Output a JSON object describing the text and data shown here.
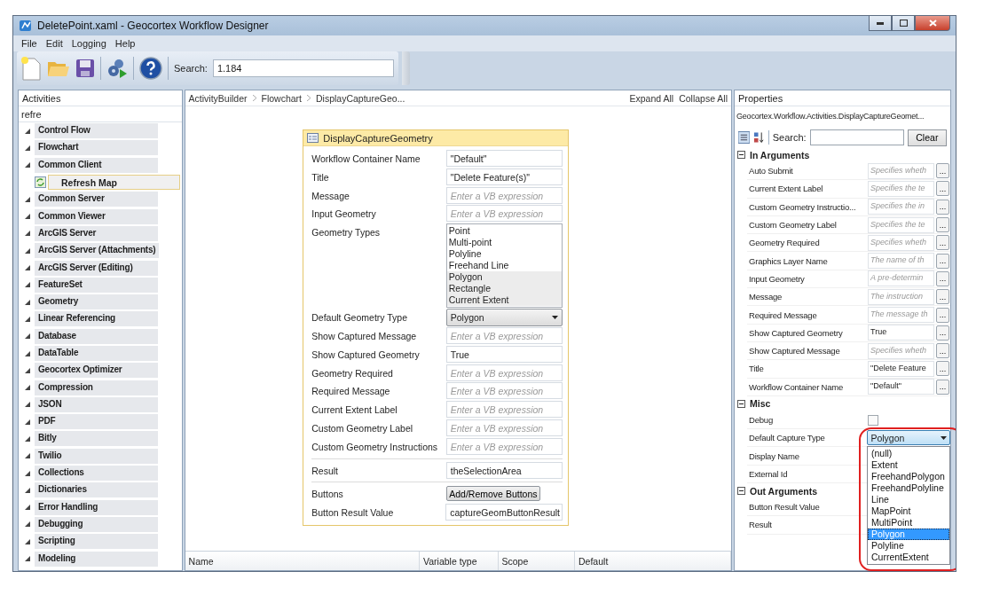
{
  "window": {
    "title": "DeletePoint.xaml - Geocortex Workflow Designer"
  },
  "menu": [
    "File",
    "Edit",
    "Logging",
    "Help"
  ],
  "toolbar": {
    "search_label": "Search:",
    "search_value": "1.184"
  },
  "activities": {
    "title": "Activities",
    "filter": "refre",
    "groups": [
      {
        "label": "Control Flow",
        "expanded": true
      },
      {
        "label": "Flowchart",
        "expanded": true
      },
      {
        "label": "Common Client",
        "expanded": true,
        "children": [
          {
            "label": "Refresh Map",
            "selected": true
          }
        ]
      },
      {
        "label": "Common Server",
        "expanded": true
      },
      {
        "label": "Common Viewer",
        "expanded": true
      },
      {
        "label": "ArcGIS Server",
        "expanded": true
      },
      {
        "label": "ArcGIS Server (Attachments)",
        "expanded": true
      },
      {
        "label": "ArcGIS Server (Editing)",
        "expanded": true
      },
      {
        "label": "FeatureSet",
        "expanded": true
      },
      {
        "label": "Geometry",
        "expanded": true
      },
      {
        "label": "Linear Referencing",
        "expanded": true
      },
      {
        "label": "Database",
        "expanded": true
      },
      {
        "label": "DataTable",
        "expanded": true
      },
      {
        "label": "Geocortex Optimizer",
        "expanded": true
      },
      {
        "label": "Compression",
        "expanded": true
      },
      {
        "label": "JSON",
        "expanded": true
      },
      {
        "label": "PDF",
        "expanded": true
      },
      {
        "label": "Bitly",
        "expanded": true
      },
      {
        "label": "Twilio",
        "expanded": true
      },
      {
        "label": "Collections",
        "expanded": true
      },
      {
        "label": "Dictionaries",
        "expanded": true
      },
      {
        "label": "Error Handling",
        "expanded": true
      },
      {
        "label": "Debugging",
        "expanded": true
      },
      {
        "label": "Scripting",
        "expanded": true
      },
      {
        "label": "Modeling",
        "expanded": true
      }
    ]
  },
  "designer": {
    "breadcrumb": [
      "ActivityBuilder",
      "Flowchart",
      "DisplayCaptureGeo..."
    ],
    "expand_all": "Expand All",
    "collapse_all": "Collapse All",
    "activity": {
      "title": "DisplayCaptureGeometry",
      "sections": [
        [
          {
            "label": "Workflow Container Name",
            "kind": "text",
            "value": "\"Default\""
          },
          {
            "label": "Title",
            "kind": "text",
            "value": "\"Delete Feature(s)\""
          },
          {
            "label": "Message",
            "kind": "text",
            "placeholder": "Enter a VB expression"
          },
          {
            "label": "Input Geometry",
            "kind": "text",
            "placeholder": "Enter a VB expression"
          },
          {
            "label": "Geometry Types",
            "kind": "list",
            "options": [
              {
                "label": "Point",
                "selected": false
              },
              {
                "label": "Multi-point",
                "selected": false
              },
              {
                "label": "Polyline",
                "selected": false
              },
              {
                "label": "Freehand Line",
                "selected": false
              },
              {
                "label": "Polygon",
                "selected": true
              },
              {
                "label": "Rectangle",
                "selected": true
              },
              {
                "label": "Current Extent",
                "selected": true
              }
            ]
          },
          {
            "label": "Default Geometry Type",
            "kind": "dropdown",
            "value": "Polygon"
          },
          {
            "label": "Show Captured Message",
            "kind": "text",
            "placeholder": "Enter a VB expression"
          },
          {
            "label": "Show Captured Geometry",
            "kind": "text",
            "value": "True"
          },
          {
            "label": "Geometry Required",
            "kind": "text",
            "placeholder": "Enter a VB expression"
          },
          {
            "label": "Required Message",
            "kind": "text",
            "placeholder": "Enter a VB expression"
          },
          {
            "label": "Current Extent Label",
            "kind": "text",
            "placeholder": "Enter a VB expression"
          },
          {
            "label": "Custom Geometry Label",
            "kind": "text",
            "placeholder": "Enter a VB expression"
          },
          {
            "label": "Custom Geometry Instructions",
            "kind": "text",
            "placeholder": "Enter a VB expression"
          }
        ],
        [
          {
            "label": "Result",
            "kind": "text",
            "value": "theSelectionArea"
          }
        ],
        [
          {
            "label": "Buttons",
            "kind": "button",
            "button": "Add/Remove Buttons"
          },
          {
            "label": "Button Result Value",
            "kind": "text",
            "value": "captureGeomButtonResult"
          }
        ]
      ]
    },
    "variables": {
      "columns": [
        "Name",
        "Variable type",
        "Scope",
        "Default"
      ]
    }
  },
  "properties": {
    "title": "Properties",
    "type_name": "Geocortex.Workflow.Activities.DisplayCaptureGeomet...",
    "search_label": "Search:",
    "clear": "Clear",
    "categories": [
      {
        "name": "In Arguments",
        "expanded": true,
        "rows": [
          {
            "name": "Auto Submit",
            "kind": "text",
            "placeholder": "Specifies wheth",
            "button": "..."
          },
          {
            "name": "Current Extent Label",
            "kind": "text",
            "placeholder": "Specifies the te",
            "button": "..."
          },
          {
            "name": "Custom Geometry Instructio...",
            "kind": "text",
            "placeholder": "Specifies the in",
            "button": "..."
          },
          {
            "name": "Custom Geometry Label",
            "kind": "text",
            "placeholder": "Specifies the te",
            "button": "..."
          },
          {
            "name": "Geometry Required",
            "kind": "text",
            "placeholder": "Specifies wheth",
            "button": "..."
          },
          {
            "name": "Graphics Layer Name",
            "kind": "text",
            "placeholder": "The name of th",
            "button": "..."
          },
          {
            "name": "Input Geometry",
            "kind": "text",
            "placeholder": "A pre-determin",
            "button": "..."
          },
          {
            "name": "Message",
            "kind": "text",
            "placeholder": "The instruction",
            "button": "..."
          },
          {
            "name": "Required Message",
            "kind": "text",
            "placeholder": "The message th",
            "button": "..."
          },
          {
            "name": "Show Captured Geometry",
            "kind": "text",
            "value": "True",
            "button": "..."
          },
          {
            "name": "Show Captured Message",
            "kind": "text",
            "placeholder": "Specifies wheth",
            "button": "..."
          },
          {
            "name": "Title",
            "kind": "text",
            "value": "\"Delete Feature",
            "button": "..."
          },
          {
            "name": "Workflow Container Name",
            "kind": "text",
            "value": "\"Default\"",
            "button": "..."
          }
        ]
      },
      {
        "name": "Misc",
        "expanded": true,
        "rows": [
          {
            "name": "Debug",
            "kind": "checkbox",
            "checked": false
          },
          {
            "name": "Default Capture Type",
            "kind": "dropdown",
            "value": "Polygon",
            "open": true,
            "options": [
              {
                "label": "(null)",
                "selected": false
              },
              {
                "label": "Extent",
                "selected": false
              },
              {
                "label": "FreehandPolygon",
                "selected": false
              },
              {
                "label": "FreehandPolyline",
                "selected": false
              },
              {
                "label": "Line",
                "selected": false
              },
              {
                "label": "MapPoint",
                "selected": false
              },
              {
                "label": "MultiPoint",
                "selected": false
              },
              {
                "label": "Polygon",
                "selected": true
              },
              {
                "label": "Polyline",
                "selected": false
              },
              {
                "label": "CurrentExtent",
                "selected": false
              }
            ]
          },
          {
            "name": "Display Name",
            "kind": "empty"
          },
          {
            "name": "External Id",
            "kind": "empty"
          }
        ]
      },
      {
        "name": "Out Arguments",
        "expanded": true,
        "rows": [
          {
            "name": "Button Result Value",
            "kind": "empty"
          },
          {
            "name": "Result",
            "kind": "empty"
          }
        ]
      }
    ]
  }
}
